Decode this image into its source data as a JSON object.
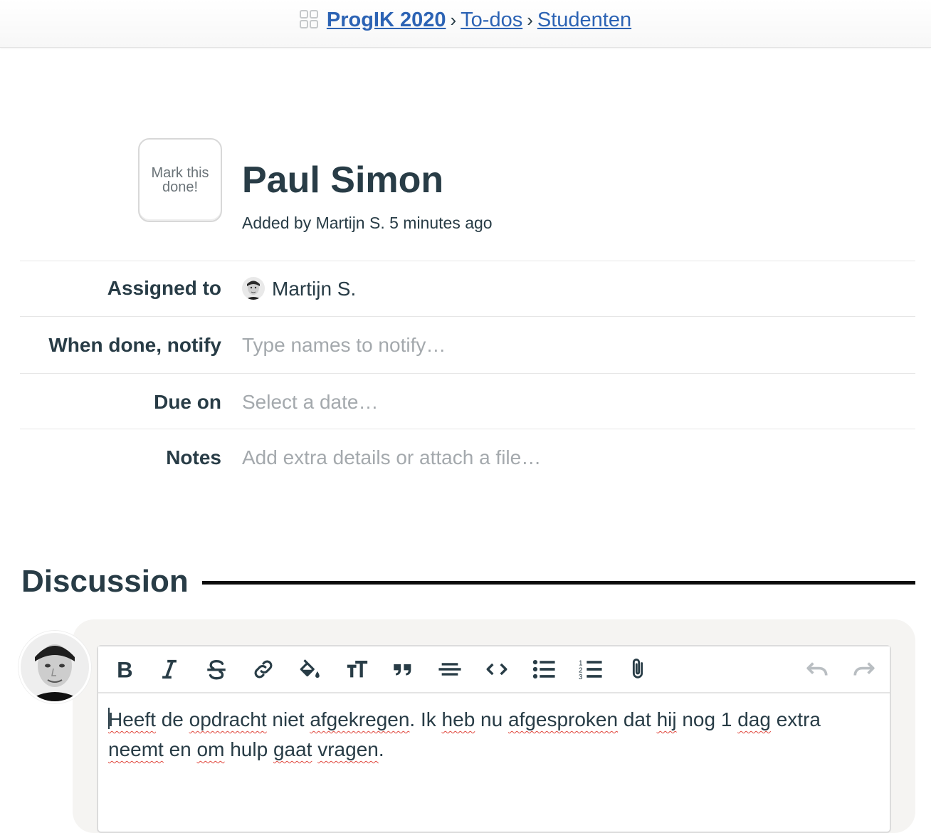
{
  "breadcrumb": {
    "project": "ProgIK 2020",
    "sep1": "›",
    "list": "To-dos",
    "sep2": "›",
    "group": "Studenten"
  },
  "todo": {
    "mark_done_label": "Mark this done!",
    "title": "Paul Simon",
    "byline": "Added by Martijn S. 5 minutes ago"
  },
  "fields": {
    "assigned_label": "Assigned to",
    "assigned_value": "Martijn S.",
    "notify_label": "When done, notify",
    "notify_placeholder": "Type names to notify…",
    "due_label": "Due on",
    "due_placeholder": "Select a date…",
    "notes_label": "Notes",
    "notes_placeholder": "Add extra details or attach a file…"
  },
  "discussion": {
    "title": "Discussion",
    "toolbar": [
      {
        "icon": "bold-icon"
      },
      {
        "icon": "italic-icon"
      },
      {
        "icon": "strikethrough-icon"
      },
      {
        "icon": "link-icon"
      },
      {
        "icon": "highlight-icon"
      },
      {
        "icon": "text-size-icon"
      },
      {
        "icon": "quote-icon"
      },
      {
        "icon": "horizontal-rule-icon"
      },
      {
        "icon": "code-icon"
      },
      {
        "icon": "bullet-list-icon"
      },
      {
        "icon": "numbered-list-icon"
      },
      {
        "icon": "attach-icon"
      },
      {
        "icon": "undo-icon"
      },
      {
        "icon": "redo-icon"
      }
    ],
    "editor_words": [
      {
        "t": "Heeft",
        "sp": true
      },
      {
        "t": " de ",
        "sp": false
      },
      {
        "t": "opdracht",
        "sp": true
      },
      {
        "t": " niet ",
        "sp": false
      },
      {
        "t": "afgekregen",
        "sp": true
      },
      {
        "t": ". Ik ",
        "sp": false
      },
      {
        "t": "heb",
        "sp": true
      },
      {
        "t": " nu ",
        "sp": false
      },
      {
        "t": "afgesproken",
        "sp": true
      },
      {
        "t": " dat ",
        "sp": false
      },
      {
        "t": "hij",
        "sp": true
      },
      {
        "t": " nog 1 ",
        "sp": false
      },
      {
        "t": "dag",
        "sp": true
      },
      {
        "t": " extra ",
        "sp": false
      },
      {
        "t": "neemt",
        "sp": true
      },
      {
        "t": " en ",
        "sp": false
      },
      {
        "t": "om",
        "sp": true
      },
      {
        "t": " hulp ",
        "sp": false
      },
      {
        "t": "gaat",
        "sp": true
      },
      {
        "t": " ",
        "sp": false
      },
      {
        "t": "vragen",
        "sp": true
      },
      {
        "t": ".",
        "sp": false
      }
    ]
  },
  "colors": {
    "text": "#283c46",
    "link": "#2c63b4",
    "placeholder": "#a4a9ad",
    "spellcheck": "#e0483e"
  }
}
